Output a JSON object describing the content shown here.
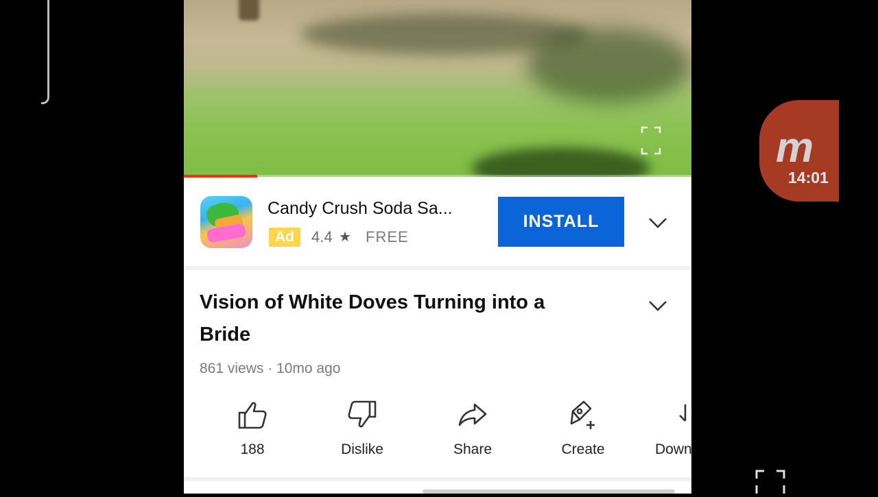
{
  "video": {
    "progress_fraction": 0.145
  },
  "ad": {
    "app_title": "Candy Crush Soda Sa...",
    "badge": "Ad",
    "rating": "4.4",
    "price": "FREE",
    "install_label": "INSTALL"
  },
  "video_info": {
    "title": "Vision of White Doves Turning into a Bride",
    "meta": "861 views · 10mo ago"
  },
  "actions": [
    {
      "label": "188",
      "icon": "thumbs-up-icon"
    },
    {
      "label": "Dislike",
      "icon": "thumbs-down-icon"
    },
    {
      "label": "Share",
      "icon": "share-icon"
    },
    {
      "label": "Create",
      "icon": "create-icon"
    },
    {
      "label": "Down",
      "icon": "download-icon"
    }
  ],
  "overlay": {
    "recorder_time": "14:01"
  },
  "colors": {
    "install": "#0b65d8",
    "progress": "#ff2a1a",
    "ad_badge": "#ffd54a",
    "recorder": "#a63a22"
  }
}
